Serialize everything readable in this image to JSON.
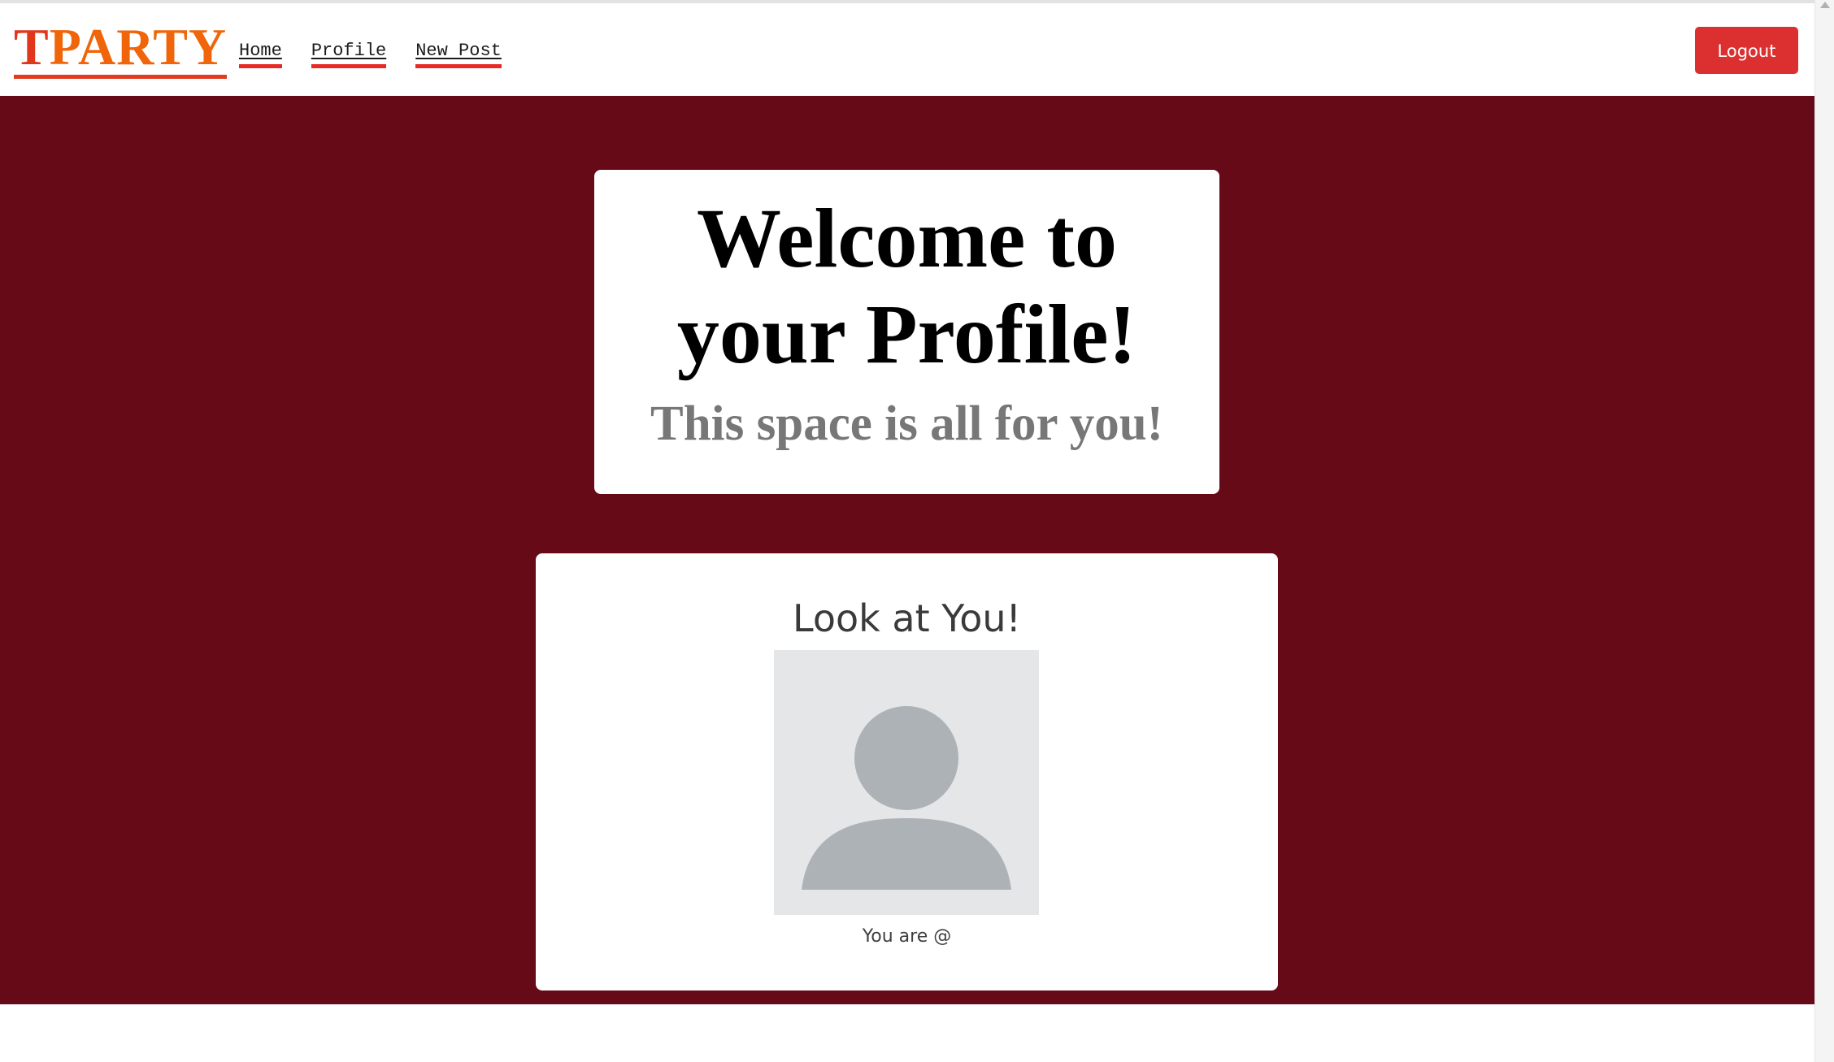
{
  "navbar": {
    "brand_first": "T",
    "brand_rest": "PARTY",
    "links": [
      {
        "label": "Home"
      },
      {
        "label": "Profile"
      },
      {
        "label": "New Post"
      }
    ],
    "logout_label": "Logout"
  },
  "welcome": {
    "title_line1": "Welcome to",
    "title_line2": "your Profile!",
    "subtitle": "This space is all for you!"
  },
  "profile_card": {
    "title": "Look at You!",
    "avatar_icon": "person-silhouette-icon",
    "username_text": "You are @"
  },
  "colors": {
    "hero_background": "#660a18",
    "brand_t": "#e0361b",
    "brand_rest": "#f0650a",
    "logout_button": "#dc3030",
    "nav_underline": "#e62a25"
  }
}
